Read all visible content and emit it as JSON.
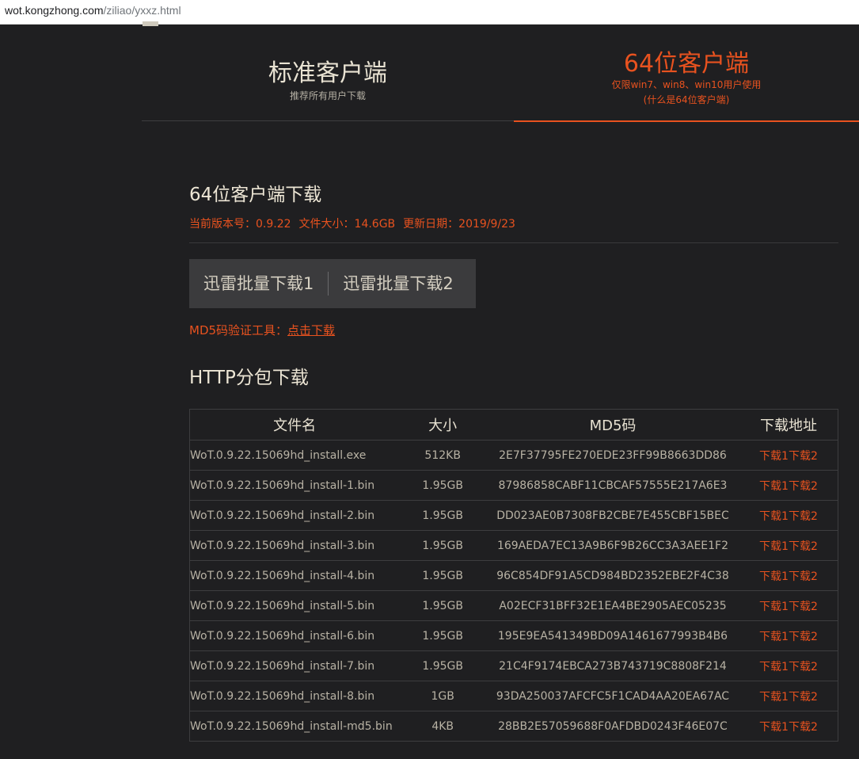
{
  "browser": {
    "url_host": "wot.kongzhong.com",
    "url_path": "/ziliao/yxxz.html"
  },
  "tabs": {
    "standard": {
      "title": "标准客户端",
      "subtitle": "推荐所有用户下载"
    },
    "x64": {
      "title": "64位客户端",
      "subtitle_1": "仅限win7、win8、win10用户使用",
      "subtitle_2": "(什么是64位客户端)"
    }
  },
  "section": {
    "title": "64位客户端下载",
    "version": "当前版本号：0.9.22",
    "filesize": "文件大小：14.6GB",
    "updated": "更新日期：2019/9/23",
    "batch1": "迅雷批量下载1",
    "batch2": "迅雷批量下载2",
    "md5_tool_label": "MD5码验证工具：",
    "md5_tool_link": "点击下载",
    "http_title": "HTTP分包下载"
  },
  "table": {
    "headers": [
      "文件名",
      "大小",
      "MD5码",
      "下载地址"
    ],
    "link1": "下载1",
    "link2": "下载2",
    "rows": [
      {
        "name": "WoT.0.9.22.15069hd_install.exe",
        "size": "512KB",
        "md5": "2E7F37795FE270EDE23FF99B8663DD86"
      },
      {
        "name": "WoT.0.9.22.15069hd_install-1.bin",
        "size": "1.95GB",
        "md5": "87986858CABF11CBCAF57555E217A6E3"
      },
      {
        "name": "WoT.0.9.22.15069hd_install-2.bin",
        "size": "1.95GB",
        "md5": "DD023AE0B7308FB2CBE7E455CBF15BEC"
      },
      {
        "name": "WoT.0.9.22.15069hd_install-3.bin",
        "size": "1.95GB",
        "md5": "169AEDA7EC13A9B6F9B26CC3A3AEE1F2"
      },
      {
        "name": "WoT.0.9.22.15069hd_install-4.bin",
        "size": "1.95GB",
        "md5": "96C854DF91A5CD984BD2352EBE2F4C38"
      },
      {
        "name": "WoT.0.9.22.15069hd_install-5.bin",
        "size": "1.95GB",
        "md5": "A02ECF31BFF32E1EA4BE2905AEC05235"
      },
      {
        "name": "WoT.0.9.22.15069hd_install-6.bin",
        "size": "1.95GB",
        "md5": "195E9EA541349BD09A1461677993B4B6"
      },
      {
        "name": "WoT.0.9.22.15069hd_install-7.bin",
        "size": "1.95GB",
        "md5": "21C4F9174EBCA273B743719C8808F214"
      },
      {
        "name": "WoT.0.9.22.15069hd_install-8.bin",
        "size": "1GB",
        "md5": "93DA250037AFCFC5F1CAD4AA20EA67AC"
      },
      {
        "name": "WoT.0.9.22.15069hd_install-md5.bin",
        "size": "4KB",
        "md5": "28BB2E57059688F0AFDBD0243F46E07C"
      }
    ]
  },
  "colors": {
    "accent": "#e8521f",
    "background": "#1f1f21"
  }
}
